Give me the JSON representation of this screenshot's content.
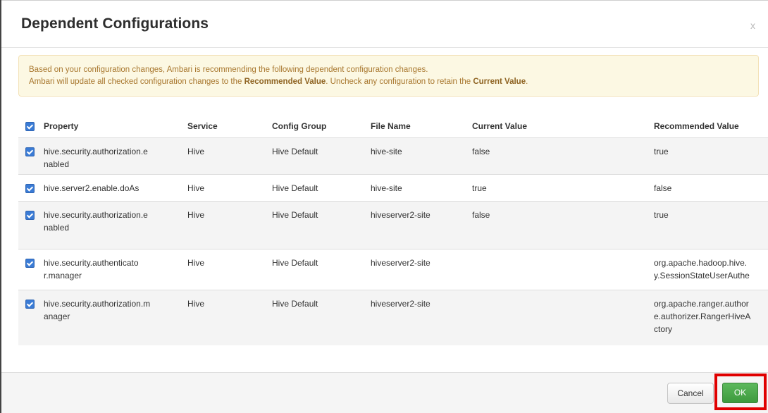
{
  "dialog": {
    "title": "Dependent Configurations",
    "close_label": "x"
  },
  "alert": {
    "line1": "Based on your configuration changes, Ambari is recommending the following dependent configuration changes.",
    "line2_a": "Ambari will update all checked configuration changes to the ",
    "line2_b": "Recommended Value",
    "line2_c": ". Uncheck any configuration to retain the ",
    "line2_d": "Current Value",
    "line2_e": "."
  },
  "table": {
    "headers": {
      "property": "Property",
      "service": "Service",
      "group": "Config Group",
      "file": "File Name",
      "current": "Current Value",
      "recommended": "Recommended Value"
    },
    "select_all_checked": true,
    "rows": [
      {
        "checked": true,
        "property_1": "hive.security.authorization.e",
        "property_2": "nabled",
        "service": "Hive",
        "group": "Hive Default",
        "file": "hive-site",
        "current": "false",
        "rec_1": "true",
        "rec_2": "",
        "rec_3": ""
      },
      {
        "checked": true,
        "property_1": "hive.server2.enable.doAs",
        "property_2": "",
        "service": "Hive",
        "group": "Hive Default",
        "file": "hive-site",
        "current": "true",
        "rec_1": "false",
        "rec_2": "",
        "rec_3": ""
      },
      {
        "checked": true,
        "property_1": "hive.security.authorization.e",
        "property_2": "nabled",
        "service": "Hive",
        "group": "Hive Default",
        "file": "hiveserver2-site",
        "current": "false",
        "rec_1": "true",
        "rec_2": "",
        "rec_3": ""
      },
      {
        "checked": true,
        "property_1": "hive.security.authenticato",
        "property_2": "r.manager",
        "service": "Hive",
        "group": "Hive Default",
        "file": "hiveserver2-site",
        "current": "",
        "rec_1": "org.apache.hadoop.hive.",
        "rec_2": "y.SessionStateUserAuthe",
        "rec_3": ""
      },
      {
        "checked": true,
        "property_1": "hive.security.authorization.m",
        "property_2": "anager",
        "service": "Hive",
        "group": "Hive Default",
        "file": "hiveserver2-site",
        "current": "",
        "rec_1": "org.apache.ranger.author",
        "rec_2": "e.authorizer.RangerHiveA",
        "rec_3": "ctory"
      }
    ]
  },
  "footer": {
    "cancel_label": "Cancel",
    "ok_label": "OK"
  },
  "colors": {
    "ok_button": "#4cae4c",
    "highlight_box": "#e00000",
    "alert_background": "#fcf8e3",
    "checkbox": "#3a7bd5"
  }
}
